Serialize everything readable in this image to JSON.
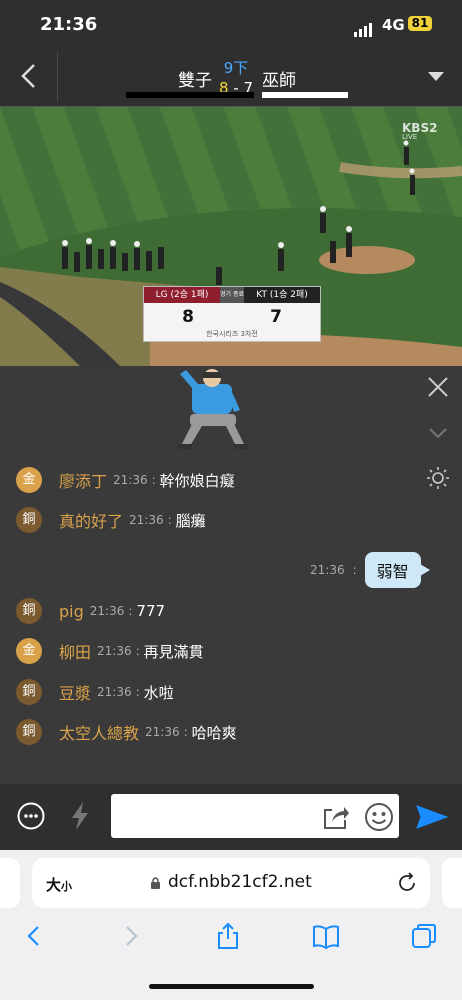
{
  "status": {
    "time": "21:36",
    "network": "4G",
    "battery": "81"
  },
  "game": {
    "home_team": "雙子",
    "away_team": "巫師",
    "inning": "9下",
    "home_score": "8",
    "dash": " - ",
    "away_score": "7"
  },
  "video": {
    "watermark": "KBS2",
    "watermark_sub": "LIVE",
    "scorebug": {
      "home_label": "LG (2승 1패)",
      "mid_label": "경기 종료",
      "away_label": "KT (1승 2패)",
      "home_score": "8",
      "away_score": "7",
      "series": "한국시리즈 3차전"
    }
  },
  "chat": {
    "messages": [
      {
        "badge": "金",
        "tier": "gold",
        "user": "廖添丁",
        "time": "21:36",
        "sep": " : ",
        "text": "幹你娘白癡"
      },
      {
        "badge": "銅",
        "tier": "bronze",
        "user": "真的好了",
        "time": "21:36",
        "sep": " : ",
        "text": "腦癱"
      },
      {
        "badge": "銅",
        "tier": "bronze",
        "user": "pig",
        "time": "21:36",
        "sep": " : ",
        "text": "777"
      },
      {
        "badge": "金",
        "tier": "gold",
        "user": "柳田",
        "time": "21:36",
        "sep": " : ",
        "text": "再見滿貫"
      },
      {
        "badge": "銅",
        "tier": "bronze",
        "user": "豆漿",
        "time": "21:36",
        "sep": " : ",
        "text": "水啦"
      },
      {
        "badge": "銅",
        "tier": "bronze",
        "user": "太空人總教",
        "time": "21:36",
        "sep": " : ",
        "text": "哈哈爽"
      }
    ],
    "my_message": {
      "time": "21:36",
      "sep": " : ",
      "text": "弱智"
    }
  },
  "input": {
    "value": "",
    "placeholder": ""
  },
  "browser": {
    "text_size_big": "大",
    "text_size_small": "小",
    "url": "dcf.nbb21cf2.net"
  },
  "colors": {
    "gold": "#d9a24a",
    "bronze": "#7a5a2e",
    "accent": "#1a8cff",
    "inning": "#4aa8ff",
    "home_score": "#f2d23a"
  },
  "icons": [
    "back-icon",
    "dropdown-icon",
    "close-icon",
    "chevron-down-icon",
    "brightness-icon",
    "chat-bubble-icon",
    "lightning-icon",
    "share-icon",
    "smile-icon",
    "send-icon",
    "lock-icon",
    "reload-icon",
    "nav-back-icon",
    "nav-forward-icon",
    "share-sheet-icon",
    "bookmarks-icon",
    "tabs-icon"
  ]
}
